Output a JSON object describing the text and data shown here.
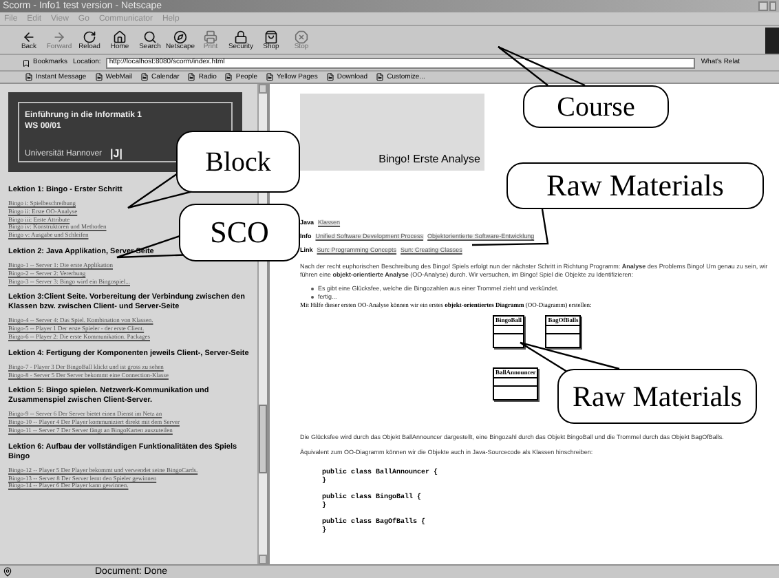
{
  "window": {
    "title": "Scorm - Info1 test version - Netscape"
  },
  "menu": [
    "File",
    "Edit",
    "View",
    "Go",
    "Communicator",
    "Help"
  ],
  "toolbar": [
    {
      "label": "Back",
      "disabled": false
    },
    {
      "label": "Forward",
      "disabled": true
    },
    {
      "label": "Reload",
      "disabled": false
    },
    {
      "label": "Home",
      "disabled": false
    },
    {
      "label": "Search",
      "disabled": false
    },
    {
      "label": "Netscape",
      "disabled": false
    },
    {
      "label": "Print",
      "disabled": true
    },
    {
      "label": "Security",
      "disabled": false
    },
    {
      "label": "Shop",
      "disabled": false
    },
    {
      "label": "Stop",
      "disabled": true
    }
  ],
  "location_bar": {
    "bookmarks": "Bookmarks",
    "location": "Location:",
    "url": "http://localhost:8080/scorm/index.html",
    "related": "What's Relat"
  },
  "personal_toolbar": [
    "Instant Message",
    "WebMail",
    "Calendar",
    "Radio",
    "People",
    "Yellow Pages",
    "Download",
    "Customize..."
  ],
  "left_frame": {
    "banner": {
      "line1": "Einführung in die Informatik 1",
      "line2": "WS 00/01",
      "university": "Universität Hannover",
      "logo": "|J|"
    },
    "lessons": [
      {
        "title": "Lektion 1: Bingo - Erster Schritt",
        "links": [
          "Bingo i: Spielbeschreibung",
          "Bingo ii: Erste OO-Analyse",
          "Bingo iii: Erste Attribute",
          "Bingo iv: Konstruktoren und Methoden",
          "Bingo v: Ausgabe und Schleifen"
        ]
      },
      {
        "title": "Lektion 2: Java Applikation, Server Seite",
        "links": [
          "Bingo-1 -- Server 1: Die erste Applikation",
          "Bingo-2 -- Server 2: Vererbung",
          "Bingo-3 -- Server 3: Bingo wird ein Bingospiel..."
        ]
      },
      {
        "title": "Lektion 3:Client Seite. Vorbereitung der Verbindung zwischen den Klassen bzw. zwischen Client- und Server-Seite",
        "links": [
          "Bingo-4 -- Server 4: Das Spiel. Kombination von Klassen.",
          "Bingo-5 -- Player 1 Der erste Spieler - der erste Client.",
          "Bingo-6 -- Player 2: Die erste Kommunikation. Packages"
        ]
      },
      {
        "title": "Lektion 4: Fertigung der Komponenten jeweils Client-, Server-Seite",
        "links": [
          "Bingo-7 - Player 3 Der BingoBall klickt und ist gross zu sehen",
          "Bingo-8 - Server 5 Der Server bekommt eine Connection-Klasse"
        ]
      },
      {
        "title": "Lektion 5: Bingo spielen. Netzwerk-Kommunikation und Zusammenspiel zwischen Client-Server.",
        "links": [
          "Bingo-9 -- Server 6 Der Server bietet einen Dienst im Netz an",
          "Bingo-10 -- Player 4 Der Player kommuniziert direkt mit dem Server",
          "Bingo-11 -- Server 7 Der Server fängt an BingoKarten auszuteilen"
        ]
      },
      {
        "title": "Lektion 6: Aufbau der vollständigen Funktionalitäten des Spiels Bingo",
        "links": [
          "Bingo-12 -- Player 5 Der Player bekommt und verwendet seine BingoCards.",
          "Bingo-13 -- Server 8 Der Server lernt den Spieler gewinnen",
          "Bingo-14 -- Player 6 Der Player kann gewinnen."
        ]
      }
    ]
  },
  "right_frame": {
    "heading": "Bingo! Erste Analyse",
    "references": [
      {
        "label": "Java",
        "links": [
          "Klassen"
        ]
      },
      {
        "label": "Info",
        "links": [
          "Unified Software Development Process",
          "Objektorientierte Software-Entwicklung"
        ]
      },
      {
        "label": "Link",
        "links": [
          "Sun: Programming Concepts",
          "Sun: Creating Classes"
        ]
      }
    ],
    "intro": "Nach der recht euphorischen Beschreibung des Bingo! Spiels erfolgt nun der nächster Schritt in Richtung Programm: **Analyse** des Problems Bingo! Um genau zu sein, wir führen eine **objekt-orientierte Analyse** (OO-Analyse) durch. Wir versuchen, im Bingo! Spiel die Objekte zu Identifizieren:",
    "bullets": [
      "Es gibt eine Glücksfee, welche die Bingozahlen aus einer Trommel zieht und verkündet.",
      "fertig..."
    ],
    "diagram_intro": "Mit Hilfe dieser ersten OO-Analyse können wir ein erstes **objekt-orientiertes Diagramm** (OO-Diagramm) erstellen:",
    "diagram_classes": [
      "BingoBall",
      "BagOfBalls",
      "BallAnnouncer"
    ],
    "explanation": "Die Glücksfee wird durch das Objekt BallAnnouncer dargestellt, eine Bingozahl durch das Objekt BingoBall und die Trommel durch das Objekt BagOfBalls.",
    "code_intro": "Äquivalent zum OO-Diagramm können wir die Objekte auch in Java-Sourcecode als Klassen hinschreiben:",
    "code": [
      "public class BallAnnouncer {",
      "}",
      "public class BingoBall {",
      "}",
      "public class BagOfBalls {",
      "}"
    ]
  },
  "status_bar": {
    "text": "Document: Done"
  },
  "callouts": [
    {
      "label": "Course"
    },
    {
      "label": "Block"
    },
    {
      "label": "SCO"
    },
    {
      "label": "Raw Materials"
    },
    {
      "label": "Raw Materials"
    }
  ]
}
